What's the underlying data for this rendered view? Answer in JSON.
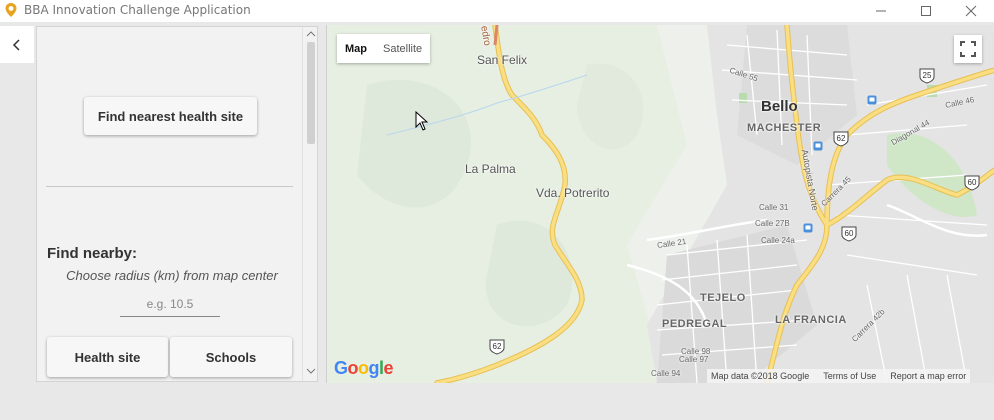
{
  "window": {
    "title": "BBA Innovation Challenge Application",
    "controls": [
      "minimize",
      "maximize",
      "close"
    ]
  },
  "nav": {
    "back_label": "<"
  },
  "panel": {
    "find_nearest_label": "Find nearest health site",
    "find_nearby_heading": "Find nearby:",
    "radius_hint": "Choose radius (km) from map center",
    "radius_placeholder": "e.g. 10.5",
    "radius_value": "",
    "health_site_label": "Health site",
    "schools_label": "Schools"
  },
  "map": {
    "type_options": [
      "Map",
      "Satellite"
    ],
    "selected_type": "Map",
    "places": {
      "san_felix": "San Felix",
      "la_palma": "La Palma",
      "vda_potrerito": "Vda. Potrerito",
      "bello": "Bello",
      "machester": "MACHESTER",
      "tejelo": "TEJELO",
      "pedregal": "PEDREGAL",
      "la_francia": "LA FRANCIA",
      "edro": "edro"
    },
    "streets": {
      "calle_55": "Calle 55",
      "calle_46": "Calle 46",
      "diagonal_44": "Diagonal 44",
      "autopista_norte": "Autopista Norte",
      "carrera_45": "Carrera 45",
      "calle_31": "Calle 31",
      "calle_27b": "Calle 27B",
      "calle_24a": "Calle 24a",
      "calle_21": "Calle 21",
      "carrera_42b": "Carrera 42b",
      "calle_98": "Calle 98",
      "calle_97": "Calle 97",
      "calle_94": "Calle 94"
    },
    "route_shields": {
      "r25": "25",
      "r62_city": "62",
      "r62_south": "62",
      "r60_east": "60",
      "r60_city": "60"
    },
    "logo_text": "Google",
    "footer": {
      "data": "Map data ©2018 Google",
      "terms": "Terms of Use",
      "report": "Report a map error"
    }
  },
  "colors": {
    "road_major": "#f9d86f",
    "road_outline": "#e5b94a",
    "urban": "#e2e2e2",
    "terrain": "#e4eee0",
    "accent_blue": "#4a90d9"
  }
}
